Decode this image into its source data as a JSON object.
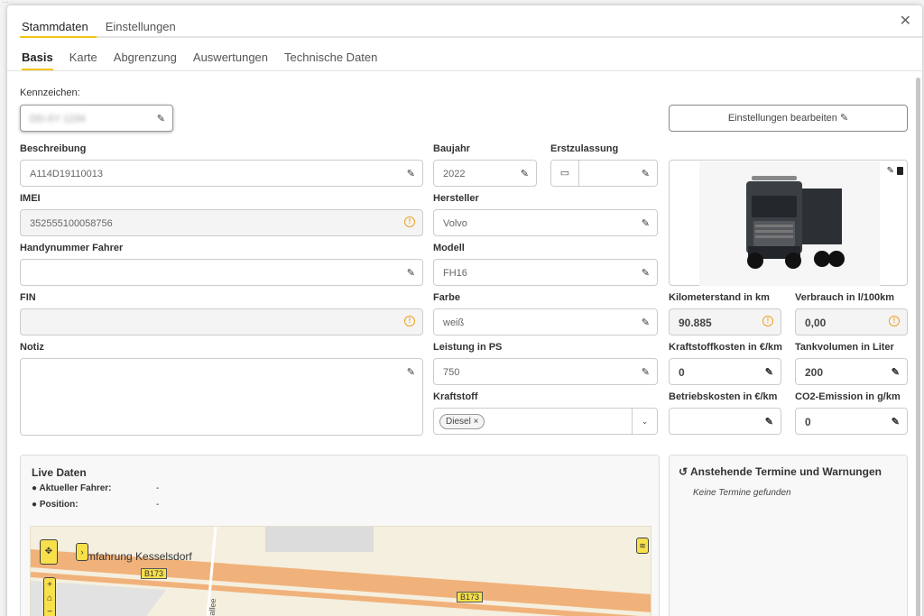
{
  "background": {
    "text": "..."
  },
  "dialog": {
    "top_tabs": [
      "Stammdaten",
      "Einstellungen"
    ],
    "sub_tabs": [
      "Basis",
      "Karte",
      "Abgrenzung",
      "Auswertungen",
      "Technische Daten"
    ],
    "close_label": "✕"
  },
  "form": {
    "kennzeichen": {
      "label": "Kennzeichen:",
      "value": "DD-XY 1234"
    },
    "einstellungen_button": "Einstellungen bearbeiten ✎",
    "beschreibung": {
      "label": "Beschreibung",
      "value": "A114D19110013"
    },
    "imei": {
      "label": "IMEI",
      "value": "352555100058756"
    },
    "handynummer": {
      "label": "Handynummer Fahrer",
      "value": ""
    },
    "fin": {
      "label": "FIN",
      "value": ""
    },
    "notiz": {
      "label": "Notiz",
      "value": ""
    },
    "baujahr": {
      "label": "Baujahr",
      "value": "2022"
    },
    "erstzulassung": {
      "label": "Erstzulassung",
      "value": ""
    },
    "hersteller": {
      "label": "Hersteller",
      "value": "Volvo"
    },
    "modell": {
      "label": "Modell",
      "value": "FH16"
    },
    "farbe": {
      "label": "Farbe",
      "value": "weiß"
    },
    "leistung": {
      "label": "Leistung in PS",
      "value": "750"
    },
    "kraftstoff": {
      "label": "Kraftstoff",
      "chip": "Diesel ×"
    },
    "kilometerstand": {
      "label": "Kilometerstand in km",
      "value": "90.885"
    },
    "verbrauch": {
      "label": "Verbrauch in l/100km",
      "value": "0,00"
    },
    "kraftstoffkosten": {
      "label": "Kraftstoffkosten in €/km",
      "value": "0"
    },
    "tankvolumen": {
      "label": "Tankvolumen in Liter",
      "value": "200"
    },
    "betriebskosten": {
      "label": "Betriebskosten in €/km",
      "value": ""
    },
    "co2": {
      "label": "CO2-Emission in g/km",
      "value": "0"
    }
  },
  "live": {
    "title": "Live Daten",
    "driver_label": "Aktueller Fahrer:",
    "driver_value": "-",
    "position_label": "Position:",
    "position_value": "-",
    "map_road": "mfahrung Kesselsdorf",
    "map_badge_1": "B173",
    "map_badge_2": "B173",
    "map_street": "allee"
  },
  "termine": {
    "title": "Anstehende Termine und Warnungen",
    "empty": "Keine Termine gefunden"
  },
  "colors": {
    "accent": "#f0c419",
    "warning": "#f0a020"
  },
  "icons": [
    "pencil-icon",
    "info-icon",
    "calendar-icon",
    "trash-icon",
    "history-icon",
    "user-icon",
    "pin-icon",
    "layers-icon",
    "close-icon"
  ]
}
